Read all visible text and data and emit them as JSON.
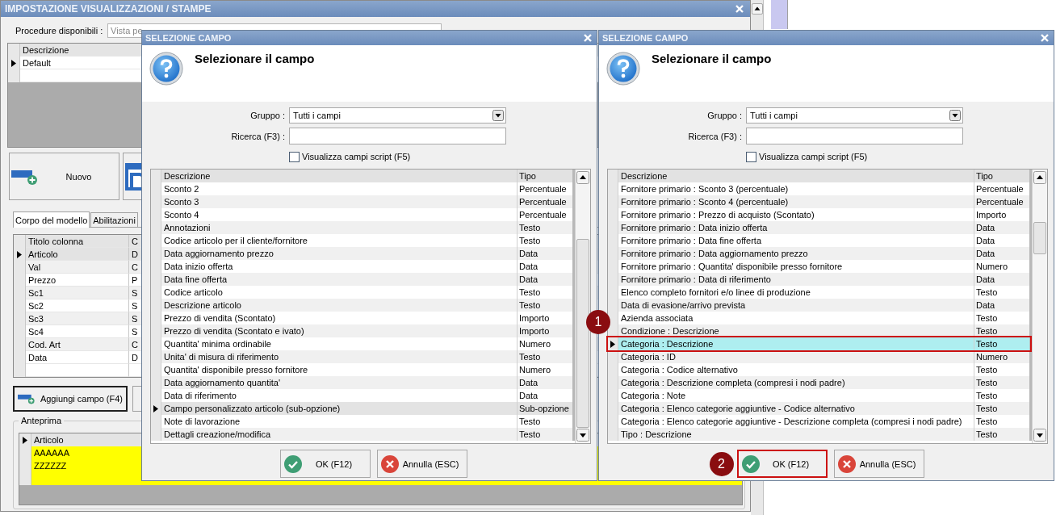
{
  "main_window": {
    "title": "IMPOSTAZIONE VISUALIZZAZIONI / STAMPE",
    "procedure_label": "Procedure disponibili :",
    "procedure_value": "Vista pe",
    "models_table": {
      "columns": [
        "Descrizione"
      ],
      "rows": [
        {
          "cells": [
            "Default"
          ],
          "selected": true
        }
      ]
    },
    "new_button": "Nuovo",
    "tabs": [
      {
        "label": "Corpo del modello",
        "selected": true
      },
      {
        "label": "Abilitazioni",
        "selected": false
      }
    ],
    "columns_table": {
      "columns": [
        "Titolo colonna",
        "C"
      ],
      "rows": [
        {
          "cells": [
            "Articolo",
            "D"
          ],
          "selected": true
        },
        {
          "cells": [
            "Val",
            "C"
          ],
          "selected": false
        },
        {
          "cells": [
            "Prezzo",
            "P"
          ],
          "selected": false
        },
        {
          "cells": [
            "Sc1",
            "S"
          ],
          "selected": false
        },
        {
          "cells": [
            "Sc2",
            "S"
          ],
          "selected": false
        },
        {
          "cells": [
            "Sc3",
            "S"
          ],
          "selected": false
        },
        {
          "cells": [
            "Sc4",
            "S"
          ],
          "selected": false
        },
        {
          "cells": [
            "Cod. Art",
            "C"
          ],
          "selected": false
        },
        {
          "cells": [
            "Data",
            "D"
          ],
          "selected": false
        }
      ]
    },
    "add_button": "Aggiungi campo (F4)",
    "preview": {
      "title": "Anteprima",
      "columns": [
        "Articolo"
      ],
      "rows": [
        {
          "cells": [
            "AAAAAA"
          ]
        },
        {
          "cells": [
            "ZZZZZZ"
          ]
        }
      ]
    }
  },
  "dialogs": [
    {
      "title": "SELEZIONE CAMPO",
      "heading": "Selezionare il campo",
      "group_label": "Gruppo :",
      "group_value": "Tutti i campi",
      "search_label": "Ricerca (F3) :",
      "script_checkbox": {
        "label": "Visualizza campi script (F5)",
        "checked": false
      },
      "focused": false,
      "columns": [
        "Descrizione",
        "Tipo"
      ],
      "rows": [
        {
          "description": "Sconto 2",
          "type": "Percentuale",
          "selected": false
        },
        {
          "description": "Sconto 3",
          "type": "Percentuale",
          "selected": false
        },
        {
          "description": "Sconto 4",
          "type": "Percentuale",
          "selected": false
        },
        {
          "description": "Annotazioni",
          "type": "Testo",
          "selected": false
        },
        {
          "description": "Codice articolo per il cliente/fornitore",
          "type": "Testo",
          "selected": false
        },
        {
          "description": "Data aggiornamento prezzo",
          "type": "Data",
          "selected": false
        },
        {
          "description": "Data inizio offerta",
          "type": "Data",
          "selected": false
        },
        {
          "description": "Data fine offerta",
          "type": "Data",
          "selected": false
        },
        {
          "description": "Codice articolo",
          "type": "Testo",
          "selected": false
        },
        {
          "description": "Descrizione articolo",
          "type": "Testo",
          "selected": false
        },
        {
          "description": "Prezzo di vendita (Scontato)",
          "type": "Importo",
          "selected": false
        },
        {
          "description": "Prezzo di vendita (Scontato e ivato)",
          "type": "Importo",
          "selected": false
        },
        {
          "description": "Quantita' minima ordinabile",
          "type": "Numero",
          "selected": false
        },
        {
          "description": "Unita' di misura di riferimento",
          "type": "Testo",
          "selected": false
        },
        {
          "description": "Quantita' disponibile presso fornitore",
          "type": "Numero",
          "selected": false
        },
        {
          "description": "Data aggiornamento quantita'",
          "type": "Data",
          "selected": false
        },
        {
          "description": "Data di riferimento",
          "type": "Data",
          "selected": false
        },
        {
          "description": "Campo personalizzato articolo (sub-opzione)",
          "type": "Sub-opzione",
          "selected": true
        },
        {
          "description": "Note di lavorazione",
          "type": "Testo",
          "selected": false
        },
        {
          "description": "Dettagli creazione/modifica",
          "type": "Testo",
          "selected": false
        }
      ],
      "ok_button": {
        "label": "OK (F12)"
      },
      "cancel_button": {
        "label": "Annulla (ESC)"
      }
    },
    {
      "title": "SELEZIONE CAMPO",
      "heading": "Selezionare il campo",
      "group_label": "Gruppo :",
      "group_value": "Tutti i campi",
      "search_label": "Ricerca (F3) :",
      "script_checkbox": {
        "label": "Visualizza campi script (F5)",
        "checked": false
      },
      "focused": true,
      "columns": [
        "Descrizione",
        "Tipo"
      ],
      "rows": [
        {
          "description": "Fornitore primario : Sconto 3 (percentuale)",
          "type": "Percentuale",
          "selected": false
        },
        {
          "description": "Fornitore primario : Sconto 4 (percentuale)",
          "type": "Percentuale",
          "selected": false
        },
        {
          "description": "Fornitore primario : Prezzo di acquisto (Scontato)",
          "type": "Importo",
          "selected": false
        },
        {
          "description": "Fornitore primario : Data inizio offerta",
          "type": "Data",
          "selected": false
        },
        {
          "description": "Fornitore primario : Data fine offerta",
          "type": "Data",
          "selected": false
        },
        {
          "description": "Fornitore primario : Data aggiornamento prezzo",
          "type": "Data",
          "selected": false
        },
        {
          "description": "Fornitore primario : Quantita' disponibile presso fornitore",
          "type": "Numero",
          "selected": false
        },
        {
          "description": "Fornitore primario : Data di riferimento",
          "type": "Data",
          "selected": false
        },
        {
          "description": "Elenco completo fornitori e/o linee di produzione",
          "type": "Testo",
          "selected": false
        },
        {
          "description": "Data di evasione/arrivo prevista",
          "type": "Data",
          "selected": false
        },
        {
          "description": "Azienda associata",
          "type": "Testo",
          "selected": false
        },
        {
          "description": "Condizione : Descrizione",
          "type": "Testo",
          "selected": false
        },
        {
          "description": "Categoria : Descrizione",
          "type": "Testo",
          "selected": true,
          "callout": "1"
        },
        {
          "description": "Categoria : ID",
          "type": "Numero",
          "selected": false
        },
        {
          "description": "Categoria : Codice alternativo",
          "type": "Testo",
          "selected": false
        },
        {
          "description": "Categoria : Descrizione completa (compresi i nodi padre)",
          "type": "Testo",
          "selected": false
        },
        {
          "description": "Categoria : Note",
          "type": "Testo",
          "selected": false
        },
        {
          "description": "Categoria : Elenco categorie aggiuntive - Codice alternativo",
          "type": "Testo",
          "selected": false
        },
        {
          "description": "Categoria : Elenco categorie aggiuntive - Descrizione completa (compresi i nodi padre)",
          "type": "Testo",
          "selected": false
        },
        {
          "description": "Tipo : Descrizione",
          "type": "Testo",
          "selected": false
        }
      ],
      "ok_button": {
        "label": "OK (F12)",
        "callout": "2"
      },
      "cancel_button": {
        "label": "Annulla (ESC)"
      }
    }
  ]
}
